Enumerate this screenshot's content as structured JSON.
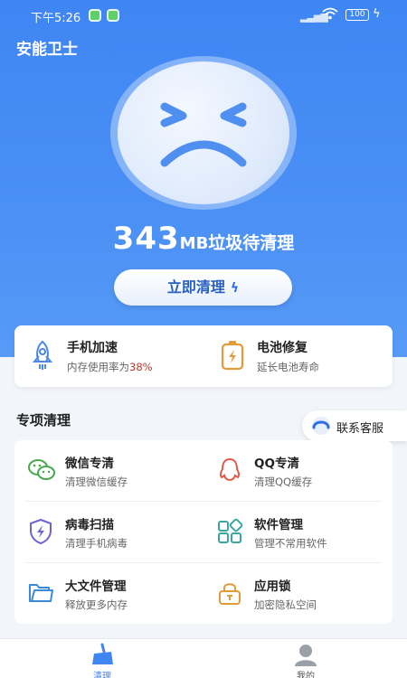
{
  "status_bar": {
    "time": "下午5:26",
    "battery": "100"
  },
  "app_title": "安能卫士",
  "junk": {
    "amount": "343",
    "unit": "MB",
    "label": "垃圾待清理"
  },
  "clean_button": {
    "label": "立即清理"
  },
  "quick_actions": [
    {
      "title": "手机加速",
      "sub_prefix": "内存使用率为",
      "sub_value": "38%",
      "icon": "rocket-icon"
    },
    {
      "title": "电池修复",
      "sub": "延长电池寿命",
      "icon": "battery-icon"
    }
  ],
  "section_title": "专项清理",
  "service_button": {
    "label": "联系客服"
  },
  "features": [
    {
      "title": "微信专清",
      "sub": "清理微信缓存",
      "icon": "wechat-icon"
    },
    {
      "title": "QQ专清",
      "sub": "清理QQ缓存",
      "icon": "qq-icon"
    },
    {
      "title": "病毒扫描",
      "sub": "清理手机病毒",
      "icon": "shield-icon"
    },
    {
      "title": "软件管理",
      "sub": "管理不常用软件",
      "icon": "apps-icon"
    },
    {
      "title": "大文件管理",
      "sub": "释放更多内存",
      "icon": "folder-icon"
    },
    {
      "title": "应用锁",
      "sub": "加密隐私空间",
      "icon": "lock-icon"
    }
  ],
  "tabs": [
    {
      "label": "清理",
      "active": true,
      "icon": "broom-icon"
    },
    {
      "label": "我的",
      "active": false,
      "icon": "user-icon"
    }
  ],
  "colors": {
    "primary": "#3f86f3",
    "accent_text": "#2a5fbf",
    "highlight": "#c0392b"
  }
}
